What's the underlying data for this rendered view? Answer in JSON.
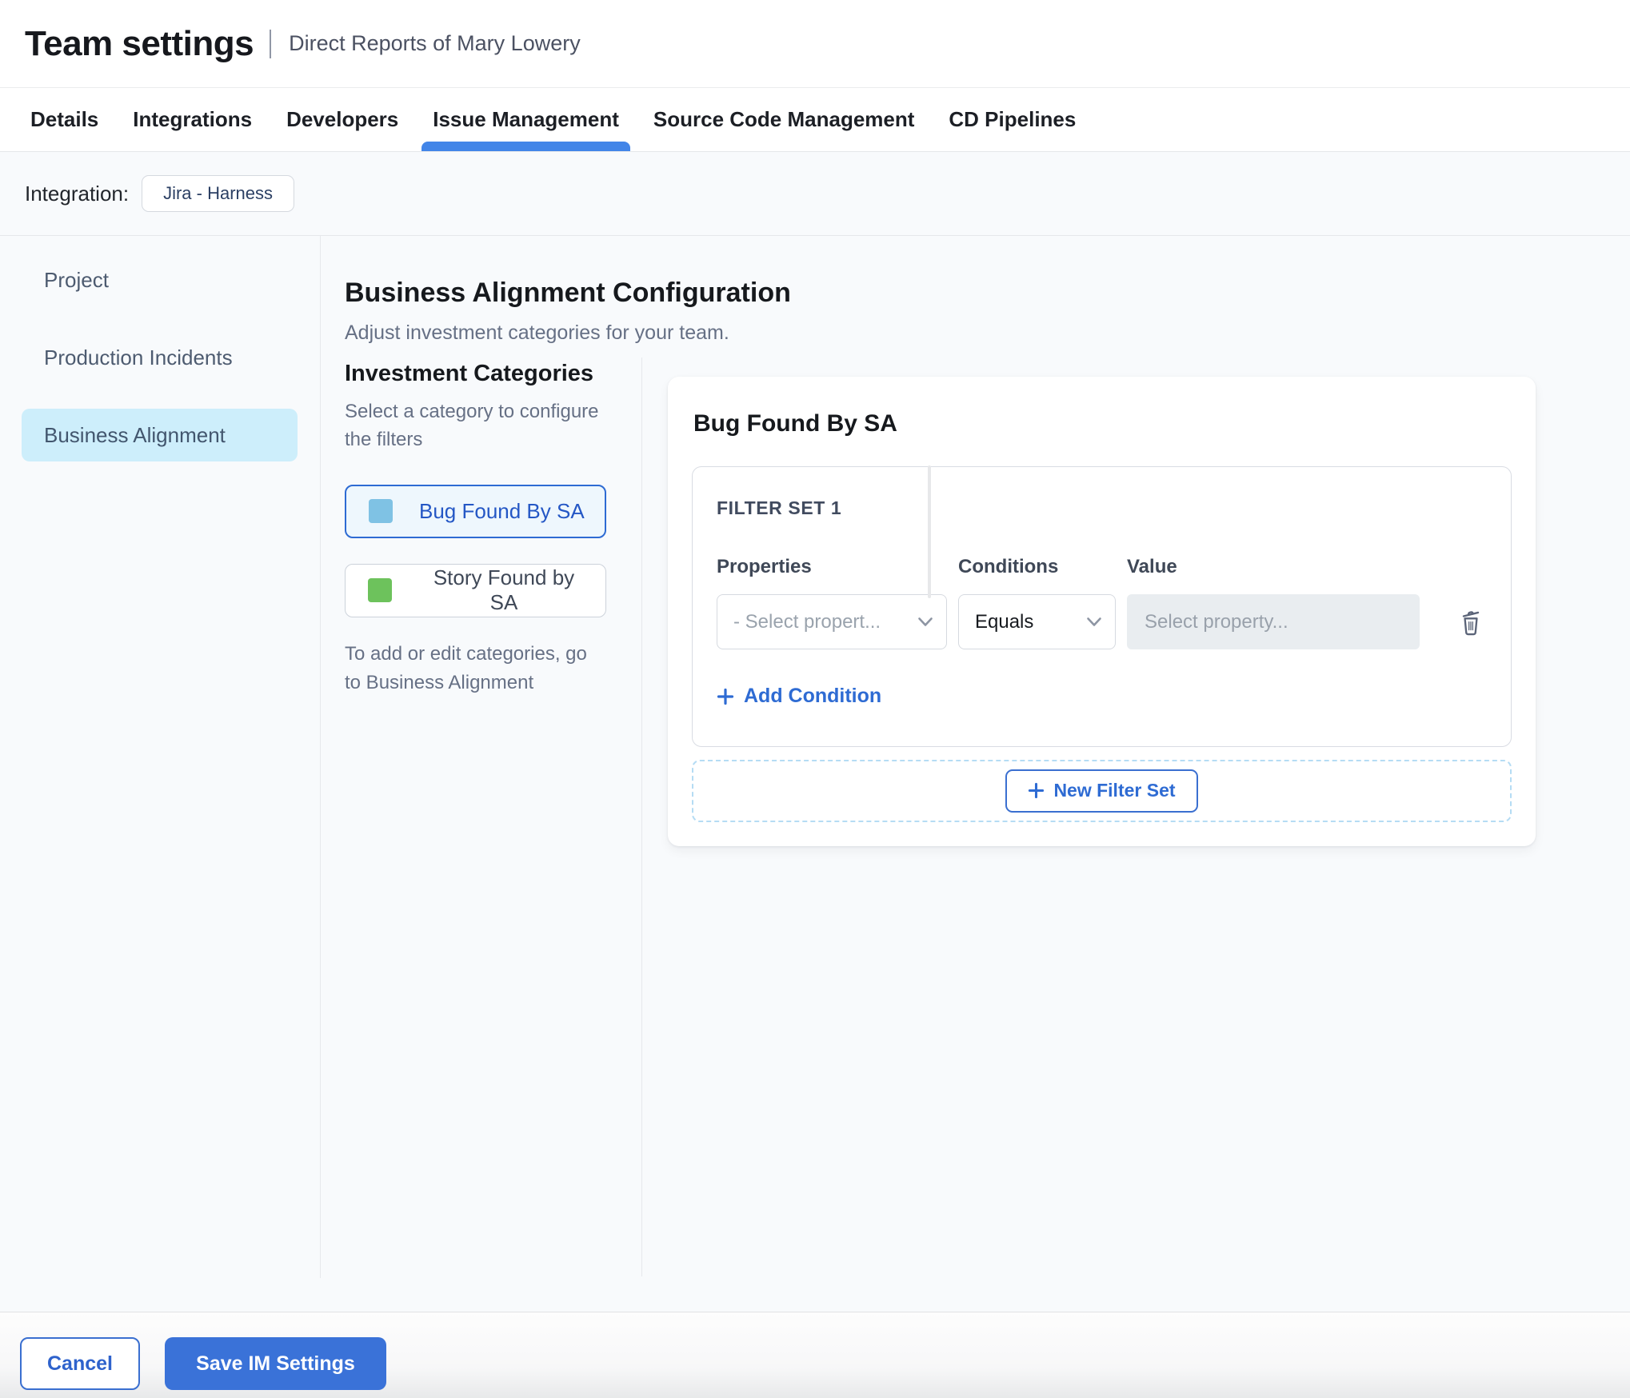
{
  "header": {
    "title": "Team settings",
    "subtitle": "Direct Reports of Mary Lowery"
  },
  "tabs": [
    {
      "label": "Details",
      "active": false
    },
    {
      "label": "Integrations",
      "active": false
    },
    {
      "label": "Developers",
      "active": false
    },
    {
      "label": "Issue Management",
      "active": true
    },
    {
      "label": "Source Code Management",
      "active": false
    },
    {
      "label": "CD Pipelines",
      "active": false
    }
  ],
  "integration": {
    "label": "Integration:",
    "chip": "Jira - Harness"
  },
  "sidebar": {
    "items": [
      {
        "label": "Project",
        "selected": false
      },
      {
        "label": "Production Incidents",
        "selected": false
      },
      {
        "label": "Business Alignment",
        "selected": true
      }
    ]
  },
  "main": {
    "title": "Business Alignment Configuration",
    "subtitle": "Adjust investment categories for your team.",
    "categories": {
      "heading": "Investment Categories",
      "hint": "Select a category to configure the filters",
      "items": [
        {
          "label": "Bug Found By SA",
          "swatch_color": "#7fc2e4",
          "selected": true
        },
        {
          "label": "Story Found by SA",
          "swatch_color": "#6dc25c",
          "selected": false
        }
      ],
      "note": "To add or edit categories, go to Business Alignment"
    },
    "filter_panel": {
      "title": "Bug Found By SA",
      "filter_set_label": "FILTER SET 1",
      "columns": [
        "Properties",
        "Conditions",
        "Value"
      ],
      "property_placeholder": "- Select propert...",
      "condition_value": "Equals",
      "value_placeholder": "Select property...",
      "add_condition_label": "Add Condition",
      "new_filter_set_label": "New Filter Set"
    }
  },
  "footer": {
    "cancel_label": "Cancel",
    "save_label": "Save IM Settings"
  },
  "colors": {
    "accent_blue": "#3a72d8",
    "link_blue": "#2e6bd3",
    "tab_underline": "#4285e8",
    "sidebar_selected_bg": "#cdeefb",
    "category_selected_bg": "#eef7fd",
    "swatch_bug": "#7fc2e4",
    "swatch_story": "#6dc25c"
  }
}
